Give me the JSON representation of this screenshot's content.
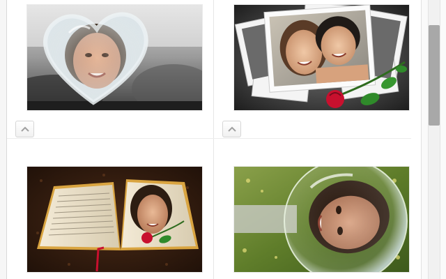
{
  "gallery": {
    "items": [
      {
        "name": "heart-frame-photo",
        "icon": "heart-frame"
      },
      {
        "name": "photo-stack-rose",
        "icon": "photo-stack"
      },
      {
        "name": "open-book-rose",
        "icon": "open-book"
      },
      {
        "name": "bubble-face-photo",
        "icon": "bubble"
      }
    ],
    "move_up_icon": "chevron-up-icon"
  },
  "colors": {
    "background": "#ffffff",
    "divider": "#e6e6e6",
    "scroll_thumb": "#a8a8a8",
    "rose": "#c8102e"
  }
}
